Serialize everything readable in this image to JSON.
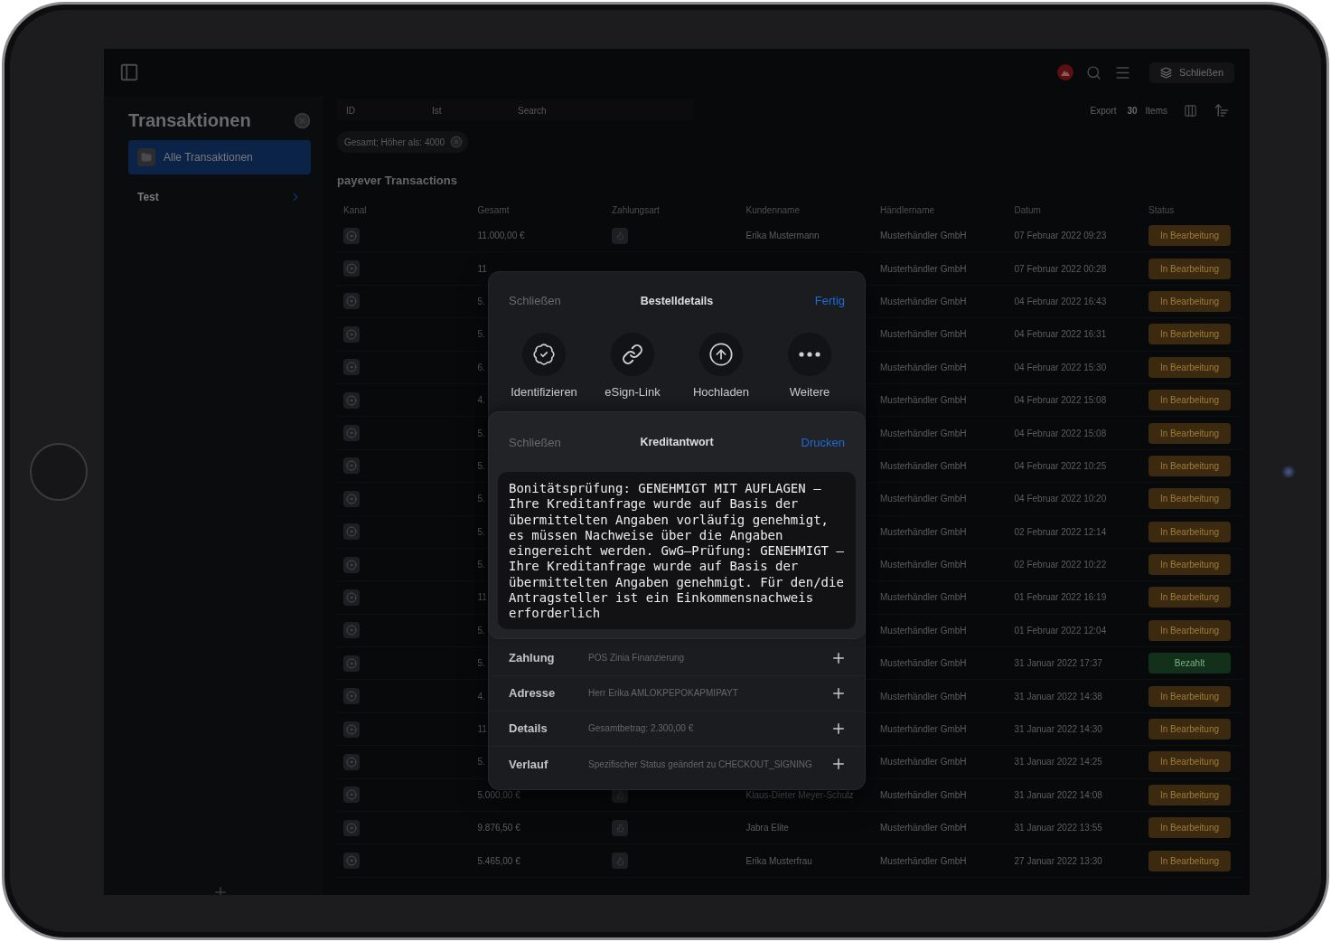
{
  "topbar": {
    "close_button": "Schließen"
  },
  "sidebar": {
    "title": "Transaktionen",
    "items": [
      {
        "label": "Alle Transaktionen",
        "selected": true,
        "kind": "folder"
      },
      {
        "label": "Test",
        "selected": false,
        "kind": "group"
      }
    ]
  },
  "filters": {
    "fields": [
      {
        "placeholder": "ID"
      },
      {
        "placeholder": "Ist"
      },
      {
        "placeholder": "Search"
      }
    ],
    "export": "Export",
    "count": "30",
    "count_label": "Items",
    "chips": [
      "Gesamt; Höher als: 4000"
    ]
  },
  "table": {
    "title": "payever Transactions",
    "columns": [
      "Kanal",
      "Gesamt",
      "Zahlungsart",
      "Kundenname",
      "Händlername",
      "Datum",
      "Status"
    ],
    "rows": [
      {
        "total": "11.000,00 €",
        "payment_icon": true,
        "customer": "Erika Mustermann",
        "merchant": "Musterhändler GmbH",
        "date": "07 Februar 2022 09:23",
        "status": {
          "label": "In Bearbeitung",
          "color": "#3b2a0f"
        }
      },
      {
        "total": "11",
        "merchant": "Musterhändler GmbH",
        "date": "07 Februar 2022 00:28",
        "status": {
          "label": "In Bearbeitung",
          "color": "#3b2a0f"
        }
      },
      {
        "total": "5.",
        "merchant": "Musterhändler GmbH",
        "date": "04 Februar 2022 16:43",
        "status": {
          "label": "In Bearbeitung",
          "color": "#3b2a0f"
        }
      },
      {
        "total": "5.",
        "merchant": "Musterhändler GmbH",
        "date": "04 Februar 2022 16:31",
        "status": {
          "label": "In Bearbeitung",
          "color": "#3b2a0f"
        }
      },
      {
        "total": "6.",
        "merchant": "Musterhändler GmbH",
        "date": "04 Februar 2022 15:30",
        "status": {
          "label": "In Bearbeitung",
          "color": "#3b2a0f"
        }
      },
      {
        "total": "4.",
        "merchant": "Musterhändler GmbH",
        "date": "04 Februar 2022 15:08",
        "status": {
          "label": "In Bearbeitung",
          "color": "#3b2a0f"
        }
      },
      {
        "total": "5.",
        "merchant": "Musterhändler GmbH",
        "date": "04 Februar 2022 15:08",
        "status": {
          "label": "In Bearbeitung",
          "color": "#3b2a0f"
        }
      },
      {
        "total": "5.",
        "merchant": "Musterhändler GmbH",
        "date": "04 Februar 2022 10:25",
        "status": {
          "label": "In Bearbeitung",
          "color": "#3b2a0f"
        }
      },
      {
        "total": "5.",
        "merchant": "Musterhändler GmbH",
        "date": "04 Februar 2022 10:20",
        "status": {
          "label": "In Bearbeitung",
          "color": "#3b2a0f"
        }
      },
      {
        "total": "5.",
        "merchant": "Musterhändler GmbH",
        "date": "02 Februar 2022 12:14",
        "status": {
          "label": "In Bearbeitung",
          "color": "#3b2a0f"
        }
      },
      {
        "total": "5.",
        "merchant": "Musterhändler GmbH",
        "date": "02 Februar 2022 10:22",
        "status": {
          "label": "In Bearbeitung",
          "color": "#3b2a0f"
        }
      },
      {
        "total": "11",
        "merchant": "Musterhändler GmbH",
        "date": "01 Februar 2022 16:19",
        "status": {
          "label": "In Bearbeitung",
          "color": "#3b2a0f"
        }
      },
      {
        "total": "5.",
        "merchant": "Musterhändler GmbH",
        "date": "01 Februar 2022 12:04",
        "status": {
          "label": "In Bearbeitung",
          "color": "#3b2a0f"
        }
      },
      {
        "total": "5.",
        "merchant": "Musterhändler GmbH",
        "date": "31 Januar 2022 17:37",
        "status": {
          "label": "Bezahlt",
          "color": "#12301a"
        }
      },
      {
        "total": "4.",
        "merchant": "Musterhändler GmbH",
        "date": "31 Januar 2022 14:38",
        "status": {
          "label": "In Bearbeitung",
          "color": "#3b2a0f"
        }
      },
      {
        "total": "11",
        "merchant": "Musterhändler GmbH",
        "date": "31 Januar 2022 14:30",
        "status": {
          "label": "In Bearbeitung",
          "color": "#3b2a0f"
        }
      },
      {
        "total": "5.",
        "merchant": "Musterhändler GmbH",
        "date": "31 Januar 2022 14:25",
        "status": {
          "label": "In Bearbeitung",
          "color": "#3b2a0f"
        }
      },
      {
        "total": "5.000,00 €",
        "payment_icon": true,
        "customer": "Klaus-Dieter Meyer-Schulz",
        "merchant": "Musterhändler GmbH",
        "date": "31 Januar 2022 14:08",
        "status": {
          "label": "In Bearbeitung",
          "color": "#3b2a0f"
        }
      },
      {
        "total": "9.876,50 €",
        "payment_icon": true,
        "customer": "Jabra Elite",
        "merchant": "Musterhändler GmbH",
        "date": "31 Januar 2022 13:55",
        "status": {
          "label": "In Bearbeitung",
          "color": "#3b2a0f"
        }
      },
      {
        "total": "5.465,00 €",
        "payment_icon": true,
        "customer": "Erika Musterfrau",
        "merchant": "Musterhändler GmbH",
        "date": "27 Januar 2022 13:30",
        "status": {
          "label": "In Bearbeitung",
          "color": "#3b2a0f"
        }
      }
    ]
  },
  "order_sheet": {
    "close": "Schließen",
    "title": "Bestelldetails",
    "done": "Fertig",
    "actions": [
      {
        "kind": "verify",
        "label": "Identifizieren"
      },
      {
        "kind": "link",
        "label": "eSign-Link"
      },
      {
        "kind": "upload",
        "label": "Hochladen"
      },
      {
        "kind": "more",
        "label": "Weitere"
      }
    ],
    "sections": [
      {
        "label": "Zahlung",
        "value": "POS Zinia Finanzierung"
      },
      {
        "label": "Adresse",
        "value": "Herr Erika AMLOKPEPOKAPMIPAYT"
      },
      {
        "label": "Details",
        "value": "Gesamtbetrag: 2.300,00 €"
      },
      {
        "label": "Verlauf",
        "value": "Spezifischer Status geändert zu CHECKOUT_SIGNING"
      }
    ]
  },
  "credit_sheet": {
    "close": "Schließen",
    "title": "Kreditantwort",
    "print": "Drucken",
    "text": "Bonitätsprüfung: GENEHMIGT MIT AUFLAGEN – Ihre Kreditanfrage wurde auf Basis der übermittelten Angaben vorläufig genehmigt, es müssen Nachweise über die Angaben eingereicht werden. GwG–Prüfung: GENEHMIGT – Ihre Kreditanfrage wurde auf Basis der übermittelten Angaben genehmigt. Für den/die Antragsteller ist ein Einkommensnachweis erforderlich"
  }
}
